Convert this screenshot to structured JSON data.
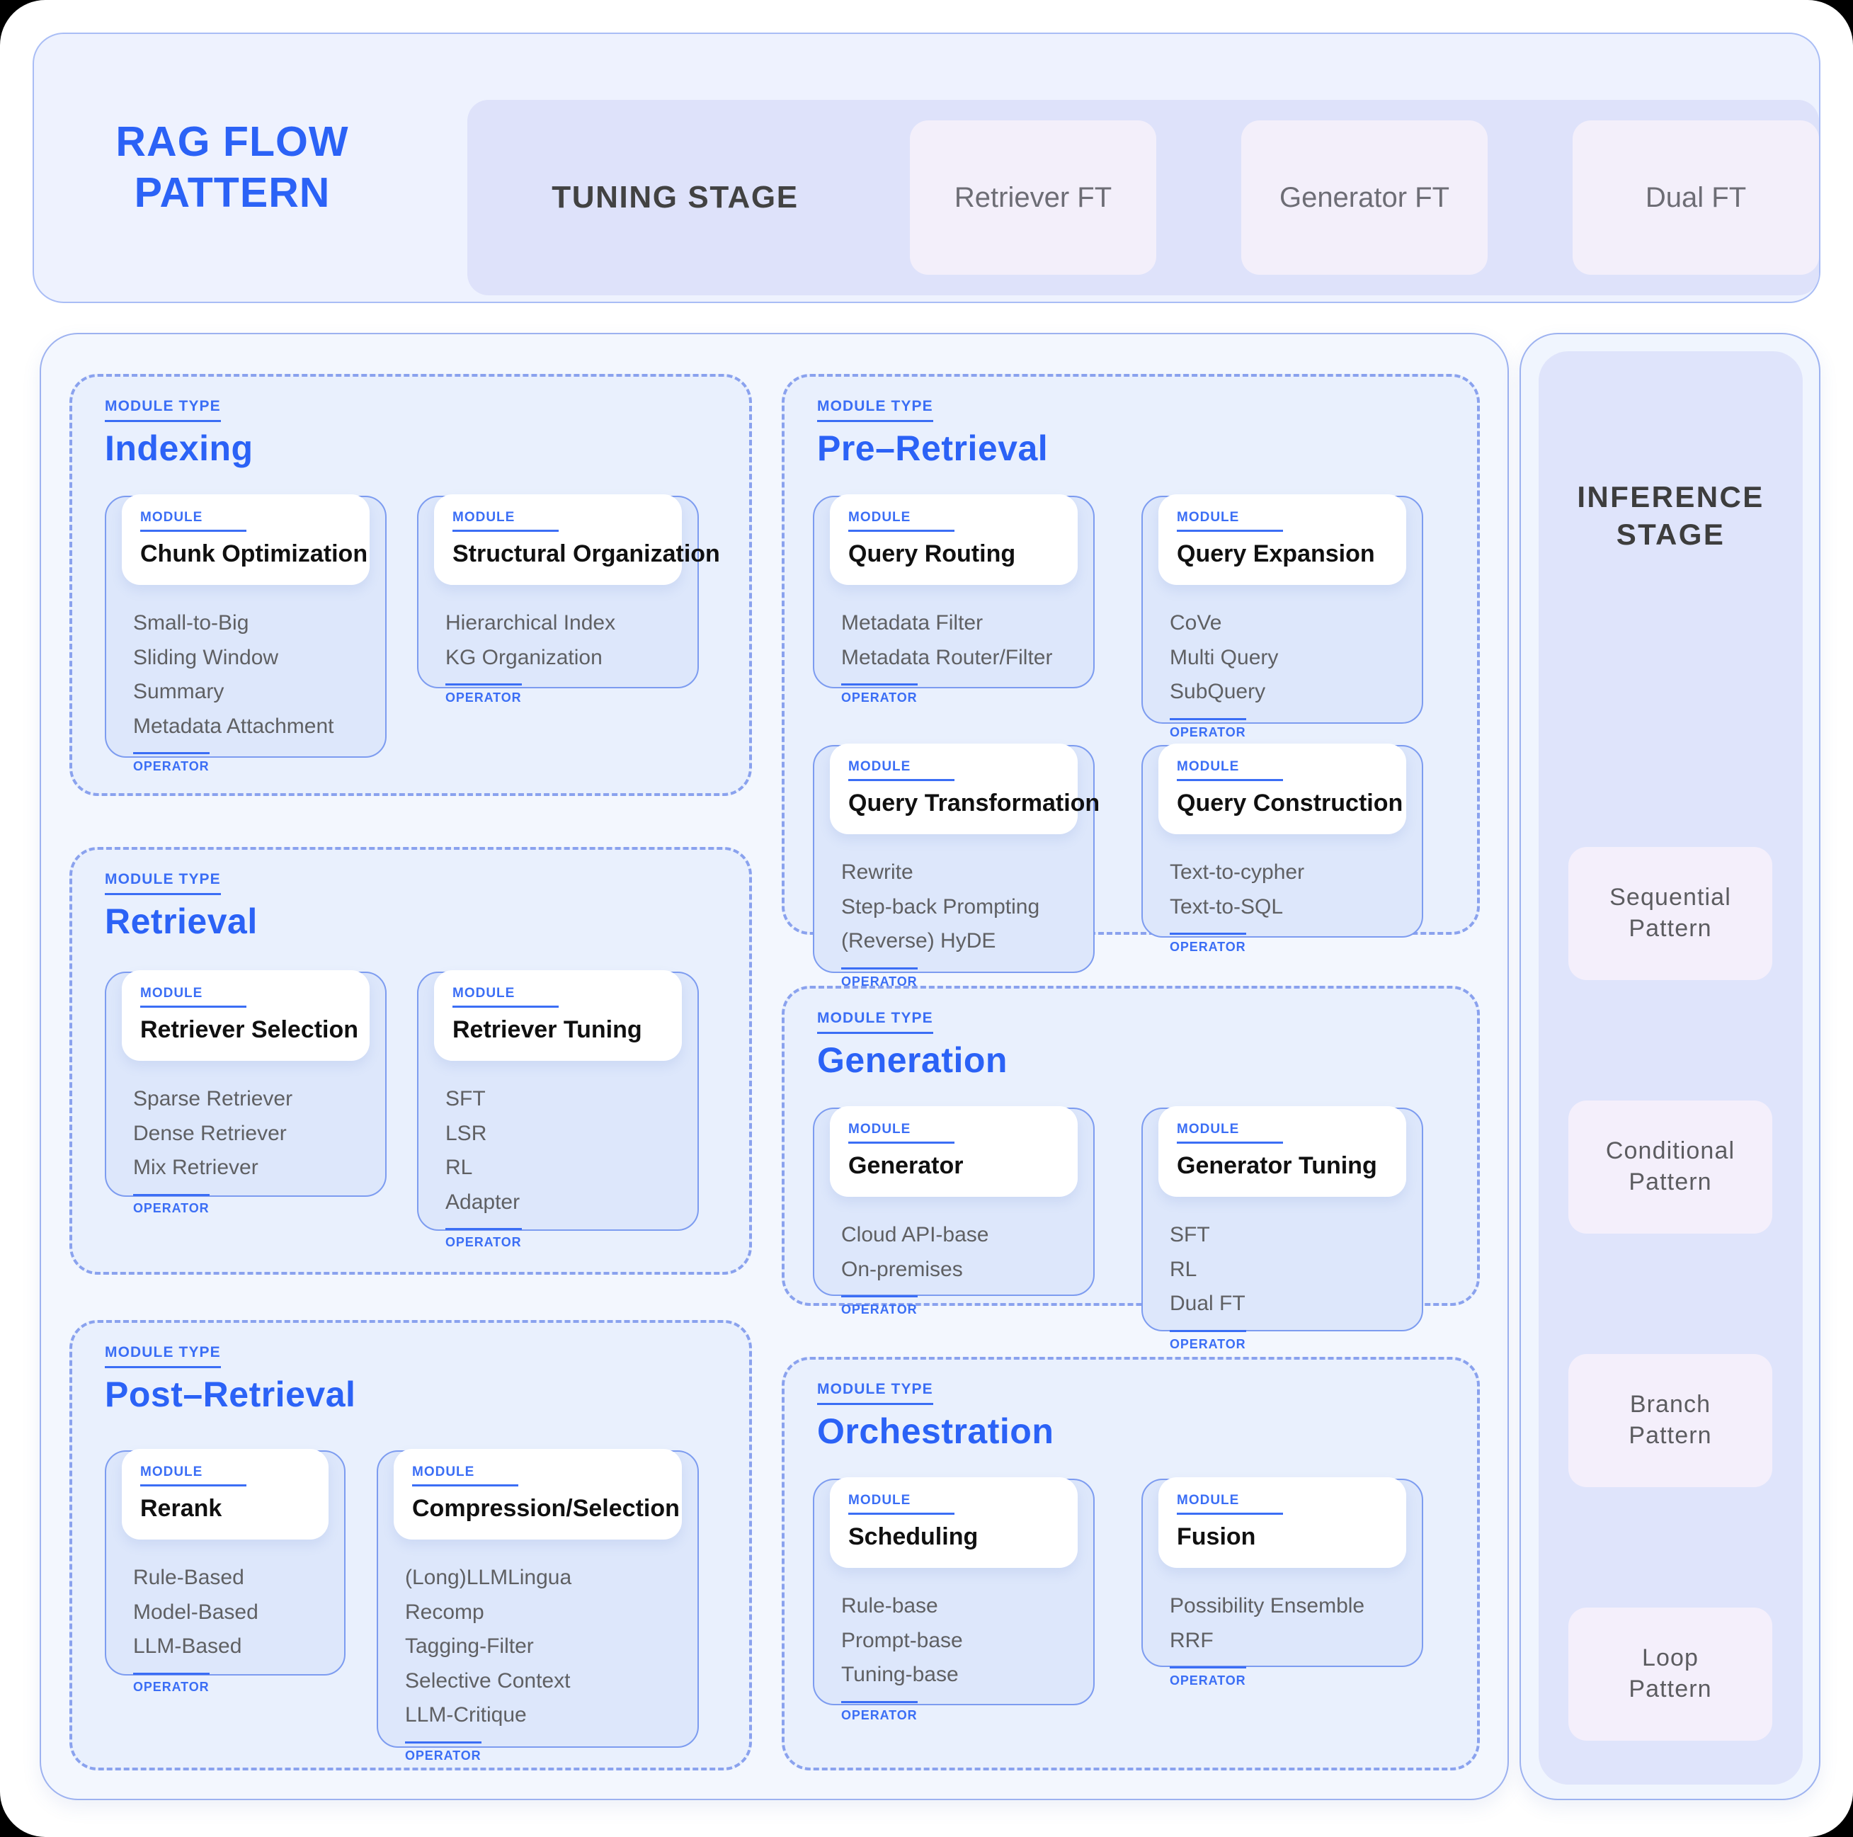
{
  "brand": {
    "title": "RAG FLOW\nPATTERN"
  },
  "header": {
    "tuning_stage_label": "TUNING STAGE",
    "ft_chips": [
      {
        "label": "Retriever FT"
      },
      {
        "label": "Generator FT"
      },
      {
        "label": "Dual FT"
      }
    ]
  },
  "labels": {
    "module_type_kicker": "MODULE TYPE",
    "module_kicker": "MODULE",
    "operator_kicker": "OPERATOR"
  },
  "colors": {
    "accent_blue": "#2b62f6",
    "kicker_blue": "#3b6ef5",
    "section_bg": "#e9f0fd",
    "module_body_bg": "#dde7fb",
    "header_panel_bg": "#eef2fe",
    "tuning_bar_bg": "#dee2fa",
    "chip_bg": "#f3effa",
    "inference_bg": "#dfe4fb",
    "page_bg": "#ffffff",
    "backdrop": "#000000"
  },
  "sections": [
    {
      "key": "indexing",
      "title": "Indexing",
      "modules": [
        {
          "title": "Chunk Optimization",
          "operators": [
            "Small-to-Big",
            "Sliding Window",
            "Summary",
            "Metadata Attachment"
          ]
        },
        {
          "title": "Structural Organization",
          "operators": [
            "Hierarchical Index",
            "KG Organization"
          ]
        }
      ]
    },
    {
      "key": "retrieval",
      "title": "Retrieval",
      "modules": [
        {
          "title": "Retriever Selection",
          "operators": [
            "Sparse Retriever",
            "Dense Retriever",
            "Mix Retriever"
          ]
        },
        {
          "title": "Retriever Tuning",
          "operators": [
            "SFT",
            "LSR",
            "RL",
            "Adapter"
          ]
        }
      ]
    },
    {
      "key": "post-retrieval",
      "title": "Post–Retrieval",
      "modules": [
        {
          "title": "Rerank",
          "operators": [
            "Rule-Based",
            "Model-Based",
            "LLM-Based"
          ]
        },
        {
          "title": "Compression/Selection",
          "operators": [
            "(Long)LLMLingua",
            "Recomp",
            "Tagging-Filter",
            "Selective Context",
            "LLM-Critique"
          ]
        }
      ]
    },
    {
      "key": "pre-retrieval",
      "title": "Pre–Retrieval",
      "modules": [
        {
          "title": "Query Routing",
          "operators": [
            "Metadata Filter",
            "Metadata Router/Filter"
          ]
        },
        {
          "title": "Query Expansion",
          "operators": [
            "CoVe",
            "Multi Query",
            "SubQuery"
          ]
        },
        {
          "title": "Query Transformation",
          "operators": [
            "Rewrite",
            "Step-back Prompting",
            "(Reverse) HyDE"
          ]
        },
        {
          "title": "Query Construction",
          "operators": [
            "Text-to-cypher",
            "Text-to-SQL"
          ]
        }
      ]
    },
    {
      "key": "generation",
      "title": "Generation",
      "modules": [
        {
          "title": "Generator",
          "operators": [
            "Cloud API-base",
            "On-premises"
          ]
        },
        {
          "title": "Generator Tuning",
          "operators": [
            "SFT",
            "RL",
            "Dual FT"
          ]
        }
      ]
    },
    {
      "key": "orchestration",
      "title": "Orchestration",
      "modules": [
        {
          "title": "Scheduling",
          "operators": [
            "Rule-base",
            "Prompt-base",
            "Tuning-base"
          ]
        },
        {
          "title": "Fusion",
          "operators": [
            "Possibility Ensemble",
            "RRF"
          ]
        }
      ]
    }
  ],
  "inference": {
    "title": "INFERENCE\nSTAGE",
    "patterns": [
      {
        "label": "Sequential\nPattern"
      },
      {
        "label": "Conditional\nPattern"
      },
      {
        "label": "Branch\nPattern"
      },
      {
        "label": "Loop\nPattern"
      }
    ]
  }
}
